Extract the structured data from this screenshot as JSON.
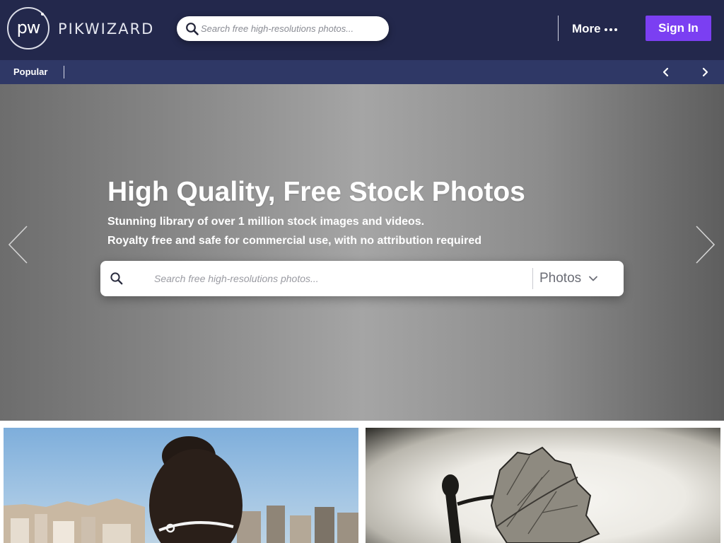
{
  "header": {
    "logo_mark": "pw",
    "logo_text": "PIKWIZARD",
    "search_placeholder": "Search free high-resolutions photos...",
    "more_label": "More",
    "signin_label": "Sign In",
    "brand_color": "#23284c",
    "accent_color": "#7b3ff2"
  },
  "subnav": {
    "items": [
      {
        "label": "Popular"
      }
    ],
    "prev_icon": "chevron-left-icon",
    "next_icon": "chevron-right-icon",
    "background": "#2f3866"
  },
  "hero": {
    "title": "High Quality, Free Stock Photos",
    "subtitle_line1": "Stunning library of over 1 million stock images and videos.",
    "subtitle_line2": "Royalty free and safe for commercial use, with no attribution required",
    "search_placeholder": "Search free high-resolutions photos...",
    "search_type": "Photos",
    "search_type_options_visible": [
      "Photos"
    ]
  },
  "photos": [
    {
      "subject": "woman-hair-bun-city"
    },
    {
      "subject": "dried-leaf-vignette"
    }
  ]
}
